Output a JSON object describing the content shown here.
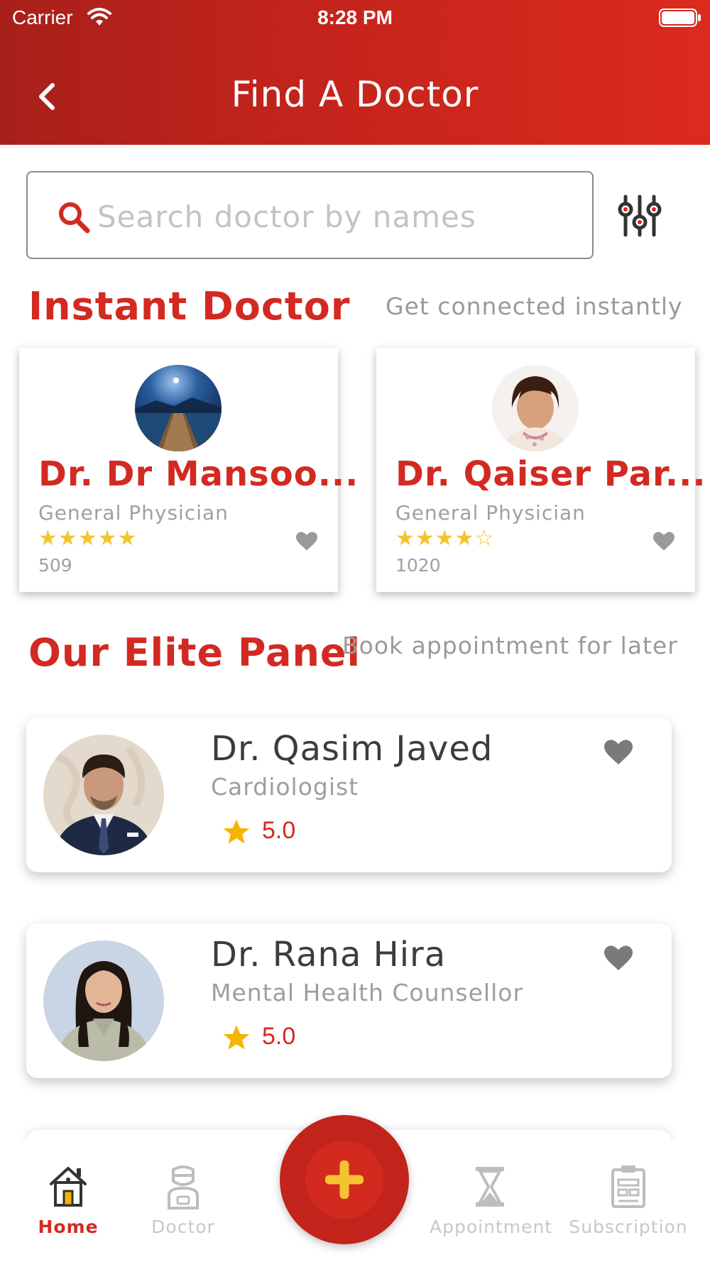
{
  "status_bar": {
    "carrier": "Carrier",
    "time": "8:28 PM"
  },
  "header": {
    "title": "Find A Doctor"
  },
  "search": {
    "placeholder": "Search doctor by names"
  },
  "instant": {
    "title": "Instant Doctor",
    "subtitle": "Get connected instantly",
    "doctors": [
      {
        "name": "Dr. Dr Mansoo...",
        "specialty": "General Physician",
        "rating": 5,
        "count": "509"
      },
      {
        "name": "Dr. Qaiser Par...",
        "specialty": "General Physician",
        "rating": 4,
        "count": "1020"
      }
    ]
  },
  "elite": {
    "title": "Our Elite Panel",
    "subtitle": "Book appointment for later",
    "doctors": [
      {
        "name": "Dr. Qasim Javed",
        "specialty": "Cardiologist",
        "rating": "5.0"
      },
      {
        "name": "Dr. Rana Hira",
        "specialty": "Mental Health Counsellor",
        "rating": "5.0"
      }
    ]
  },
  "nav": {
    "home": "Home",
    "doctor": "Doctor",
    "appointment": "Appointment",
    "subscription": "Subscription"
  },
  "colors": {
    "primary": "#d22a22",
    "header_start": "#a8201a",
    "header_end": "#dc2a1e",
    "star": "#f4c430",
    "muted": "#9e9e9e"
  }
}
